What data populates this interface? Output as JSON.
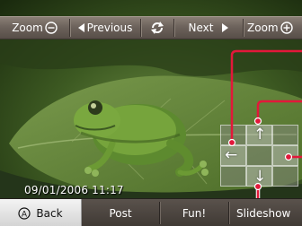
{
  "toolbar": {
    "zoom_out_label": "Zoom",
    "previous_label": "Previous",
    "next_label": "Next",
    "zoom_in_label": "Zoom"
  },
  "photo": {
    "timestamp": "09/01/2006 11:17"
  },
  "bottom": {
    "back_glyph": "A",
    "back_label": "Back",
    "post_label": "Post",
    "fun_label": "Fun!",
    "slideshow_label": "Slideshow"
  },
  "colors": {
    "callout": "#e2183a",
    "toolbar": "#6d635c",
    "back_button": "#e6e6e6"
  },
  "icons": [
    "zoom-out-icon",
    "previous-arrow-icon",
    "rotate-icon",
    "next-arrow-icon",
    "zoom-in-icon",
    "a-button-icon",
    "arrow-left-icon",
    "arrow-up-icon",
    "arrow-down-icon"
  ]
}
